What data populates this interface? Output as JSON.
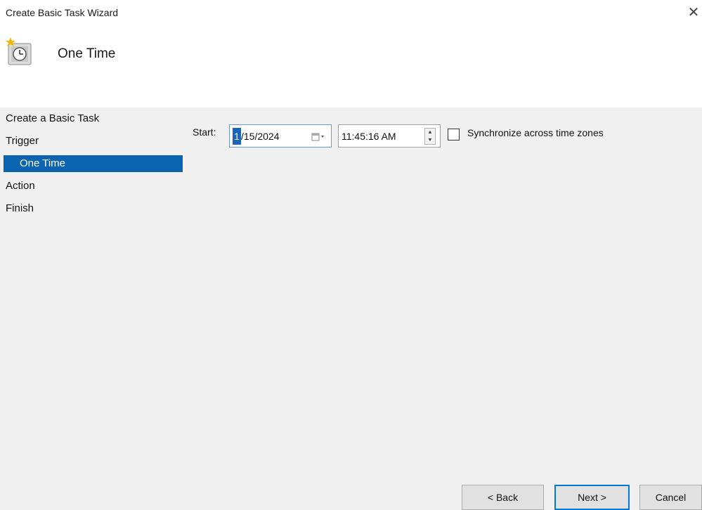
{
  "window": {
    "title": "Create Basic Task Wizard",
    "close_glyph": "✕"
  },
  "header": {
    "title": "One Time",
    "icon": "task-clock-icon"
  },
  "nav": {
    "items": [
      {
        "label": "Create a Basic Task"
      },
      {
        "label": "Trigger"
      },
      {
        "label": "One Time",
        "selected": true
      },
      {
        "label": "Action"
      },
      {
        "label": "Finish"
      }
    ]
  },
  "form": {
    "start_label": "Start:",
    "date_highlight": "1",
    "date_rest": "/15/2024",
    "time_value": "11:45:16 AM",
    "sync_label": "Synchronize across time zones",
    "sync_checked": false
  },
  "buttons": {
    "back": "< Back",
    "next": "Next >",
    "cancel": "Cancel"
  },
  "colors": {
    "selected_bg": "#0a64b0",
    "content_bg": "#f0f0f0",
    "focus_border": "#0078d7"
  }
}
